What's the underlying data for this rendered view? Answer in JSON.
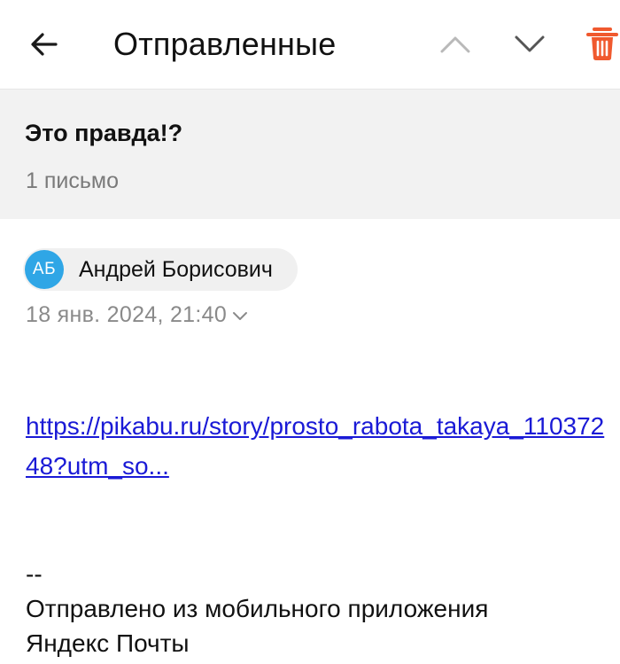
{
  "header": {
    "title": "Отправленные",
    "back_icon": "arrow-left-icon",
    "up_icon": "chevron-up-icon",
    "down_icon": "chevron-down-icon",
    "trash_icon": "trash-icon",
    "trash_color": "#f0592e"
  },
  "thread": {
    "subject": "Это правда!?",
    "count_label": "1 письмо"
  },
  "message": {
    "sender": {
      "initials": "АБ",
      "name": "Андрей Борисович",
      "avatar_color": "#2fa6e6"
    },
    "date": "18 янв. 2024, 21:40",
    "link_text": "https://pikabu.ru/story/prosto_rabota_takaya_11037248?utm_so...",
    "signature": {
      "separator": "--",
      "line1": "Отправлено из мобильного приложения",
      "line2": "Яндекс Почты"
    }
  },
  "colors": {
    "accent_link": "#1a1ad6",
    "panel_bg": "#f2f2f2",
    "muted_text": "#8a8a8a"
  }
}
